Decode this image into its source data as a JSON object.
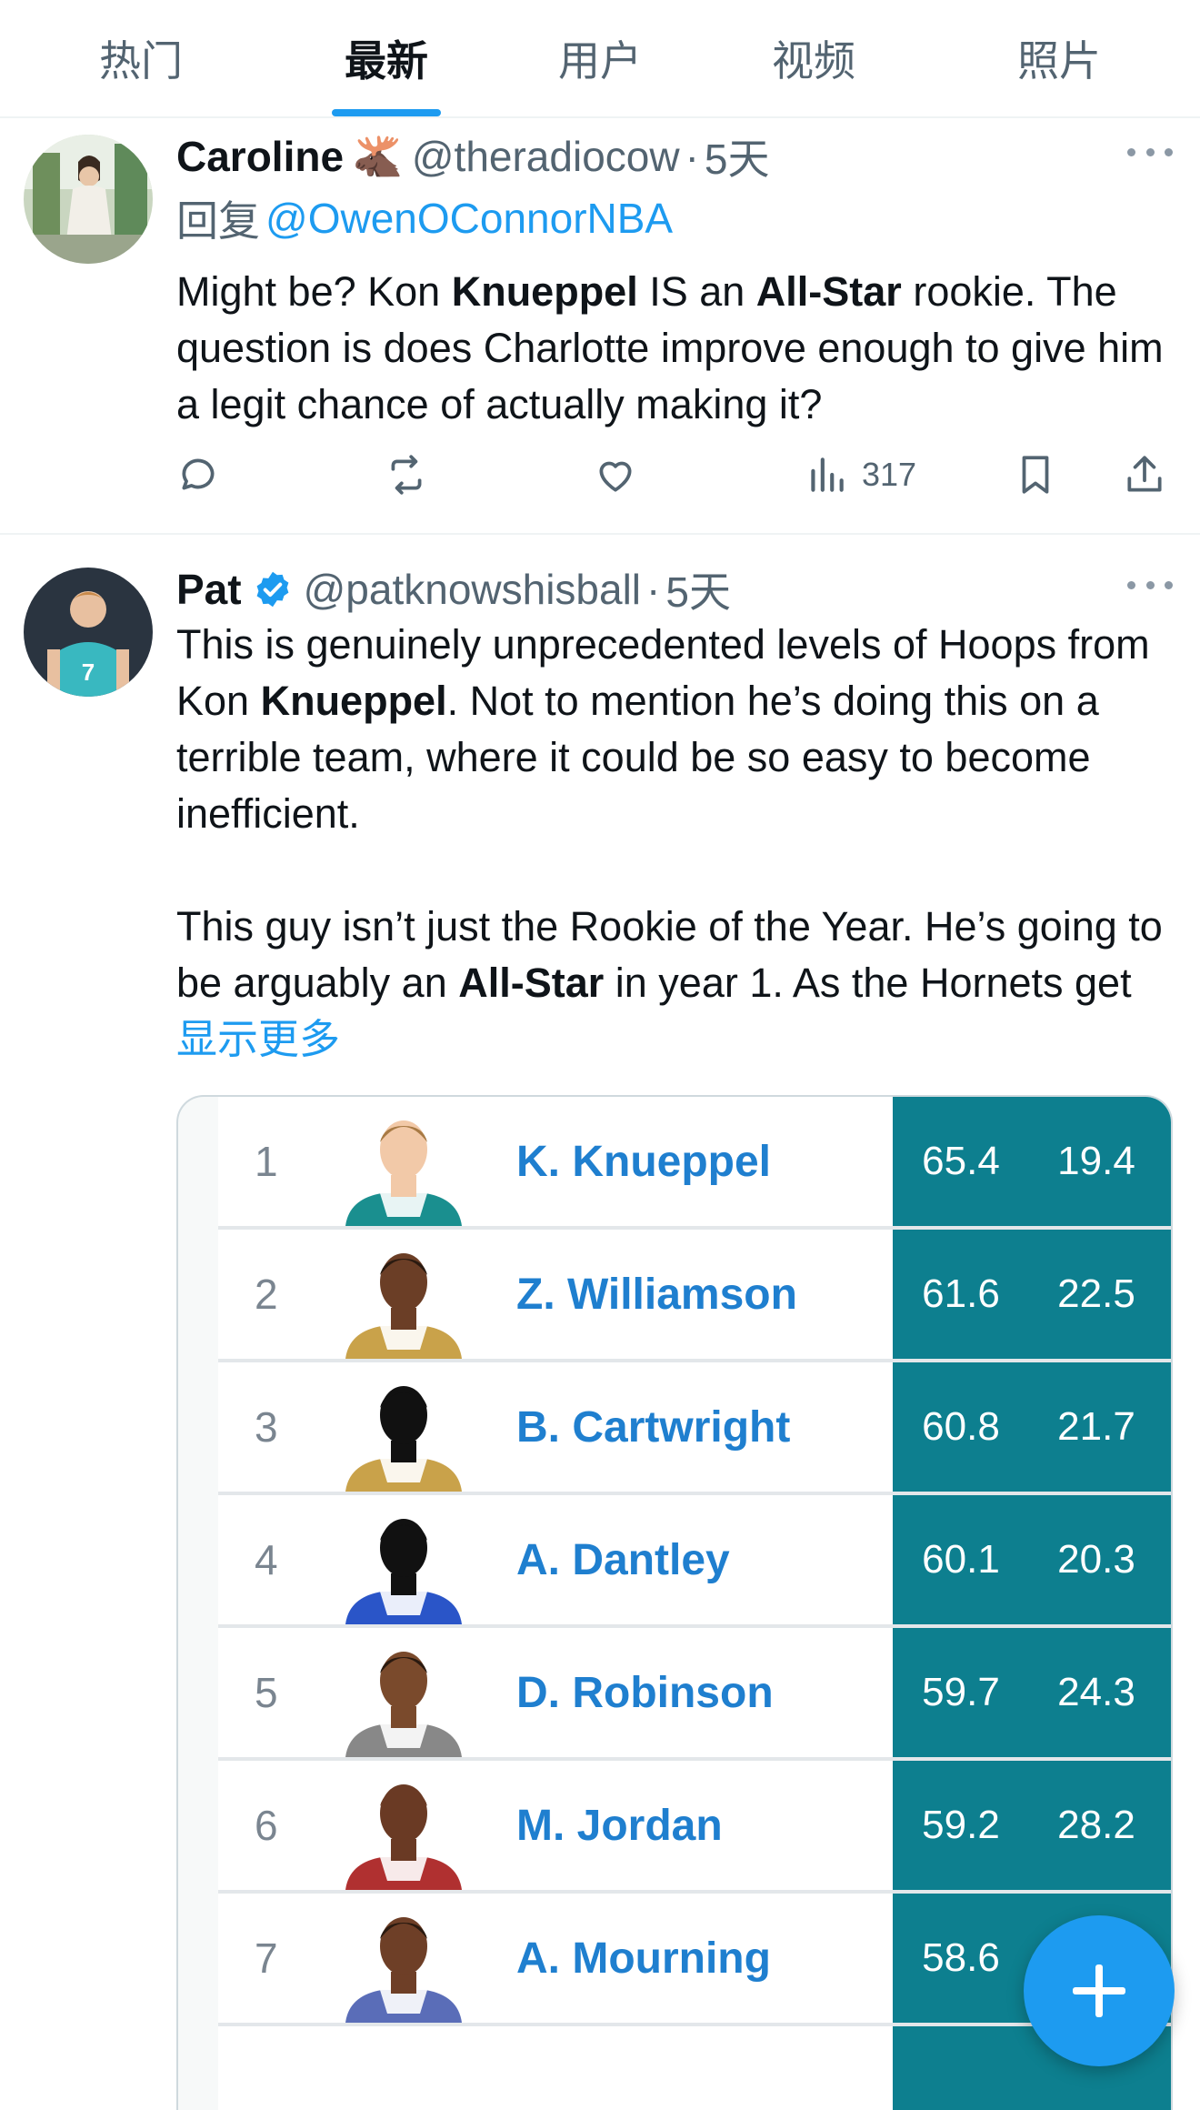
{
  "tabs": [
    {
      "label": "热门",
      "active": false
    },
    {
      "label": "最新",
      "active": true
    },
    {
      "label": "用户",
      "active": false
    },
    {
      "label": "视频",
      "active": false
    },
    {
      "label": "照片",
      "active": false
    }
  ],
  "tweets": [
    {
      "name": "Caroline",
      "emoji": "🫎",
      "handle": "@theradiocow",
      "dot": "·",
      "time": "5天",
      "reply_prefix": "回复",
      "reply_mention": "@OwenOConnorNBA",
      "text_parts": [
        "Might be? Kon ",
        "Knueppel",
        " IS an ",
        "All-Star",
        " rookie. The question is does Charlotte improve enough to give him a legit chance of actually making it?"
      ],
      "views": "317"
    },
    {
      "name": "Pat",
      "handle": "@patknowshisball",
      "dot": "·",
      "time": "5天",
      "para1_parts": [
        "This is genuinely unprecedented levels of Hoops from Kon ",
        "Knueppel",
        ". Not to mention he’s doing this on a terrible team, where it could be so easy to become inefficient."
      ],
      "para2_parts": [
        "This guy isn’t just the Rookie of the Year. He’s going to be arguably an ",
        "All-Star",
        " in year 1. As the Hornets get "
      ],
      "show_more": "显示更多"
    }
  ],
  "table": {
    "rows": [
      {
        "rank": "1",
        "name": "K. Knueppel",
        "v1": "65.4",
        "v2": "19.4",
        "skin": "#f2c9a8",
        "hair": "#a87a44",
        "jersey": "#1a8f8f"
      },
      {
        "rank": "2",
        "name": "Z. Williamson",
        "v1": "61.6",
        "v2": "22.5",
        "skin": "#6b3e26",
        "hair": "#2a1a10",
        "jersey": "#c9a24a"
      },
      {
        "rank": "3",
        "name": "B. Cartwright",
        "v1": "60.8",
        "v2": "21.7",
        "skin": "#111111",
        "hair": "#111111",
        "jersey": "#c9a24a"
      },
      {
        "rank": "4",
        "name": "A. Dantley",
        "v1": "60.1",
        "v2": "20.3",
        "skin": "#111111",
        "hair": "#111111",
        "jersey": "#2a55c8"
      },
      {
        "rank": "5",
        "name": "D. Robinson",
        "v1": "59.7",
        "v2": "24.3",
        "skin": "#7a4a2c",
        "hair": "#2a1a10",
        "jersey": "#888888"
      },
      {
        "rank": "6",
        "name": "M. Jordan",
        "v1": "59.2",
        "v2": "28.2",
        "skin": "#6a3a24",
        "hair": "#6a3a24",
        "jersey": "#b03030"
      },
      {
        "rank": "7",
        "name": "A. Mourning",
        "v1": "58.6",
        "v2": "",
        "skin": "#6e3f27",
        "hair": "#2a1a10",
        "jersey": "#5a6db8"
      }
    ]
  },
  "colors": {
    "accent": "#1d9bf0",
    "stat_panel": "#0d7f8f",
    "player_link": "#1f7fcf"
  }
}
